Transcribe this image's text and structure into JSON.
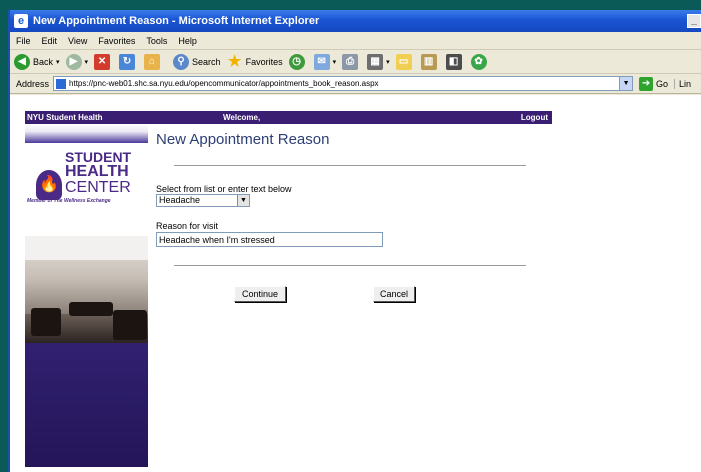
{
  "window": {
    "title": "New Appointment Reason - Microsoft Internet Explorer",
    "minimize": "_"
  },
  "menu": [
    "File",
    "Edit",
    "View",
    "Favorites",
    "Tools",
    "Help"
  ],
  "toolbar": {
    "back": "Back",
    "search": "Search",
    "favorites": "Favorites"
  },
  "address": {
    "label": "Address",
    "url": "https://pnc-web01.shc.sa.nyu.edu/opencommunicator/appointments_book_reason.aspx",
    "go": "Go",
    "links": "Lin"
  },
  "site": {
    "brand": "NYU Student Health",
    "welcome": "Welcome,",
    "logout": "Logout"
  },
  "logo": {
    "line1": "STUDENT",
    "line2": "HEALTH",
    "line3": "CENTER",
    "tagline": "Member of The Wellness Exchange"
  },
  "page": {
    "title": "New Appointment Reason",
    "select_label": "Select from list or enter text below",
    "select_value": "Headache",
    "reason_label": "Reason for visit",
    "reason_value": "Headache when I'm stressed",
    "continue": "Continue",
    "cancel": "Cancel"
  },
  "colors": {
    "site_bar": "#3a1e72",
    "title_text": "#2c3f74",
    "xp_titlebar": "#1a55d2"
  }
}
